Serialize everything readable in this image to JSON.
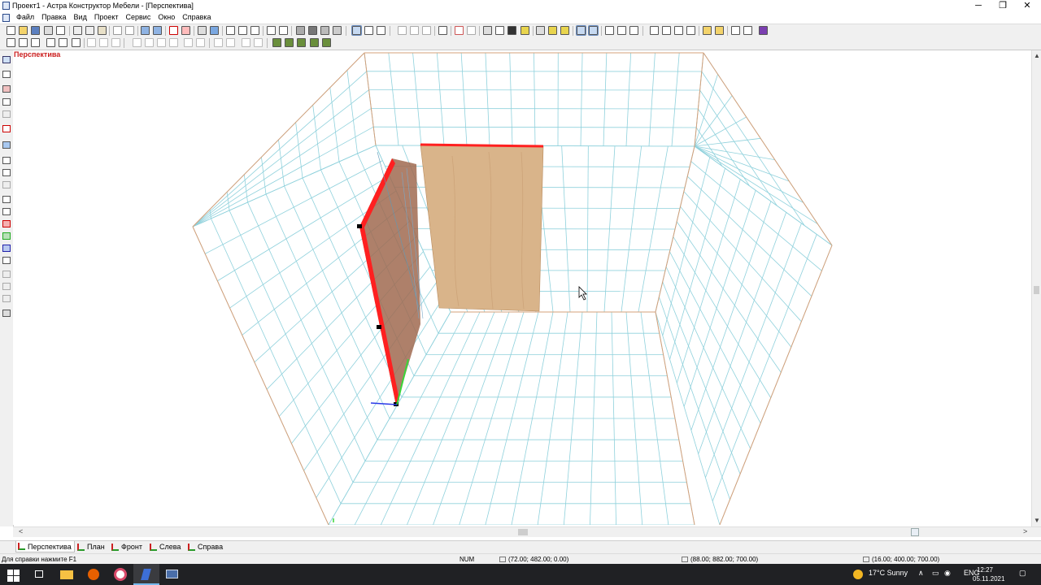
{
  "window": {
    "title": "Проект1 - Астра Конструктор Мебели - [Перспектива]",
    "minimize": "─",
    "restore": "❐",
    "close": "✕"
  },
  "menu": [
    "Файл",
    "Правка",
    "Вид",
    "Проект",
    "Сервис",
    "Окно",
    "Справка"
  ],
  "viewport": {
    "label": "Перспектива"
  },
  "view_tabs": [
    "Перспектива",
    "План",
    "Фронт",
    "Слева",
    "Справа"
  ],
  "status": {
    "help": "Для справки нажмите F1",
    "num": "NUM",
    "coord1": "(72.00; 482.00; 0.00)",
    "coord2": "(88.00; 882.00; 700.00)",
    "coord3": "(16.00; 400.00; 700.00)"
  },
  "taskbar": {
    "weather": "17°C  Sunny",
    "lang": "ENG",
    "time": "12:27",
    "date": "05.11.2021"
  },
  "colors": {
    "panel_edge": "#ff2020",
    "wood": "#d9b48a",
    "grid": "#8fd1dc",
    "room_edge": "#d4a07a"
  }
}
